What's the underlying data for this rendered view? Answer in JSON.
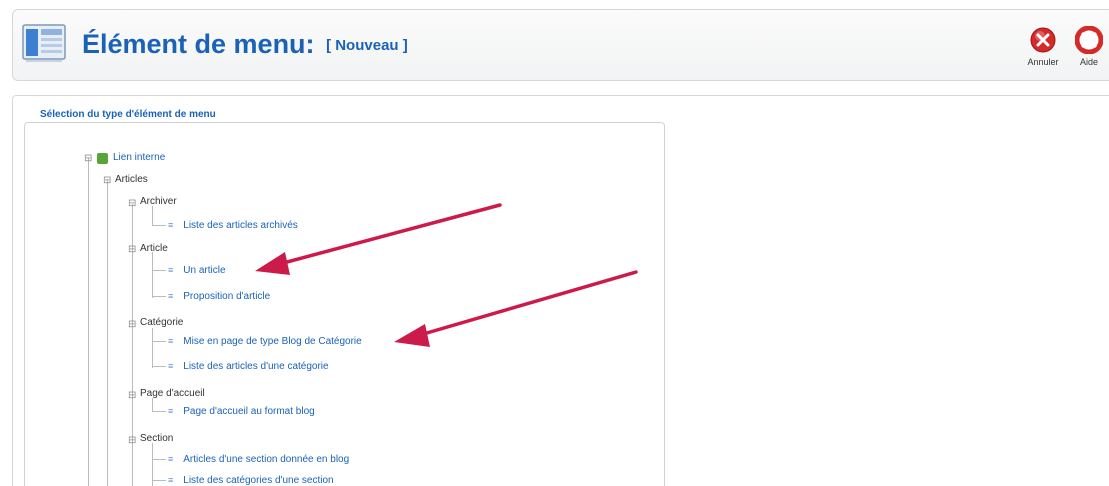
{
  "header": {
    "title": "Élément de menu:",
    "title_suffix": "[ Nouveau ]",
    "icon": "menu-item-icon"
  },
  "toolbar": {
    "cancel_label": "Annuler",
    "help_label": "Aide",
    "cancel_icon": "cancel-icon",
    "help_icon": "help-icon"
  },
  "panel": {
    "legend": "Sélection du type d'élément de menu"
  },
  "tree": {
    "root": "Lien interne",
    "articles": "Articles",
    "archiver": "Archiver",
    "archiver_item_1": "Liste des articles archivés",
    "article": "Article",
    "article_item_1": "Un article",
    "article_item_2": "Proposition d'article",
    "categorie": "Catégorie",
    "categorie_item_1": "Mise en page de type Blog de Catégorie",
    "categorie_item_2": "Liste des articles d'une catégorie",
    "accueil": "Page d'accueil",
    "accueil_item_1": "Page d'accueil au format blog",
    "section": "Section",
    "section_item_1": "Articles d'une section donnée en blog",
    "section_item_2": "Liste des catégories d'une section"
  },
  "colors": {
    "title": "#1a62b8",
    "arrow": "#cc1b4a",
    "cancel": "#d42a2a"
  }
}
